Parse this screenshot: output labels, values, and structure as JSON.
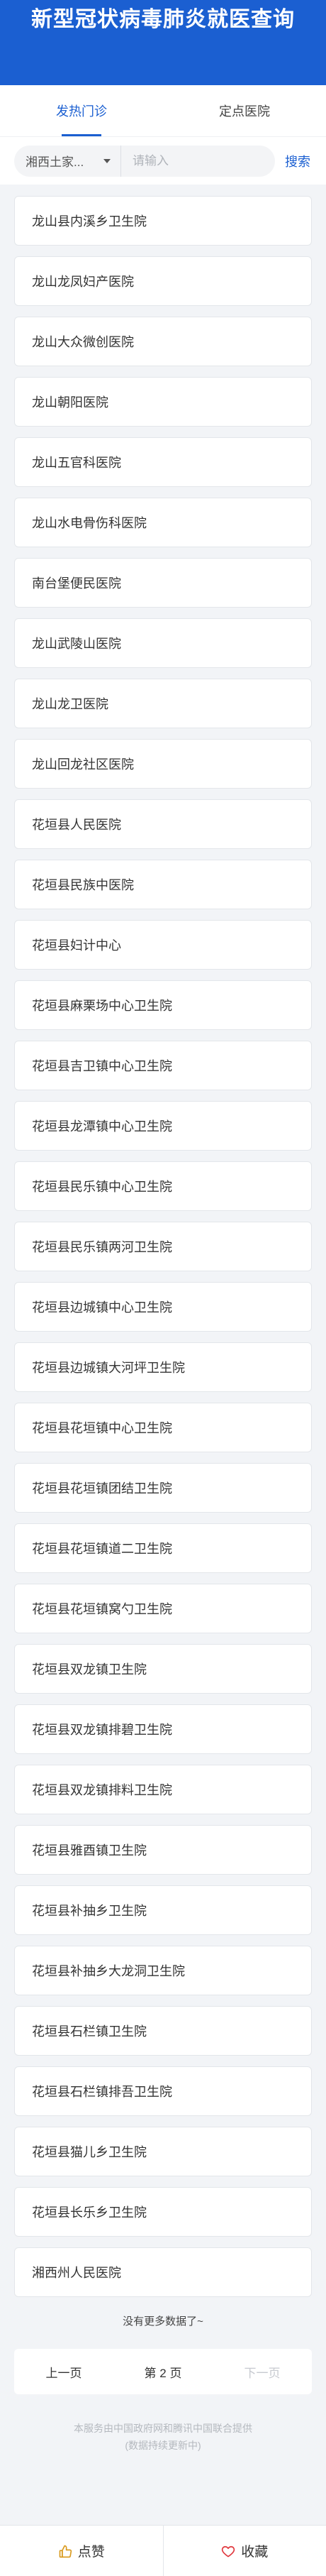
{
  "header": {
    "title": "新型冠状病毒肺炎就医查询"
  },
  "tabs": [
    {
      "label": "发热门诊",
      "active": true
    },
    {
      "label": "定点医院",
      "active": false
    }
  ],
  "search": {
    "region": "湘西土家...",
    "placeholder": "请输入",
    "button_label": "搜索"
  },
  "hospitals": [
    "龙山县内溪乡卫生院",
    "龙山龙凤妇产医院",
    "龙山大众微创医院",
    "龙山朝阳医院",
    "龙山五官科医院",
    "龙山水电骨伤科医院",
    "南台堡便民医院",
    "龙山武陵山医院",
    "龙山龙卫医院",
    "龙山回龙社区医院",
    "花垣县人民医院",
    "花垣县民族中医院",
    "花垣县妇计中心",
    "花垣县麻栗场中心卫生院",
    "花垣县吉卫镇中心卫生院",
    "花垣县龙潭镇中心卫生院",
    "花垣县民乐镇中心卫生院",
    "花垣县民乐镇两河卫生院",
    "花垣县边城镇中心卫生院",
    "花垣县边城镇大河坪卫生院",
    "花垣县花垣镇中心卫生院",
    "花垣县花垣镇团结卫生院",
    "花垣县花垣镇道二卫生院",
    "花垣县花垣镇窝勺卫生院",
    "花垣县双龙镇卫生院",
    "花垣县双龙镇排碧卫生院",
    "花垣县双龙镇排料卫生院",
    "花垣县雅酉镇卫生院",
    "花垣县补抽乡卫生院",
    "花垣县补抽乡大龙洞卫生院",
    "花垣县石栏镇卫生院",
    "花垣县石栏镇排吾卫生院",
    "花垣县猫儿乡卫生院",
    "花垣县长乐乡卫生院",
    "湘西州人民医院"
  ],
  "no_more_text": "没有更多数据了~",
  "pagination": {
    "prev": "上一页",
    "current": "第 2 页",
    "next": "下一页"
  },
  "footer": {
    "line1": "本服务由中国政府网和腾讯中国联合提供",
    "line2": "(数据持续更新中)"
  },
  "bottom_bar": {
    "like": "点赞",
    "favorite": "收藏"
  },
  "colors": {
    "brand": "#1b5fd1",
    "background": "#f2f4f7"
  },
  "icons": {
    "like": "thumbs-up-icon",
    "favorite": "heart-icon",
    "dropdown": "caret-down-icon"
  }
}
